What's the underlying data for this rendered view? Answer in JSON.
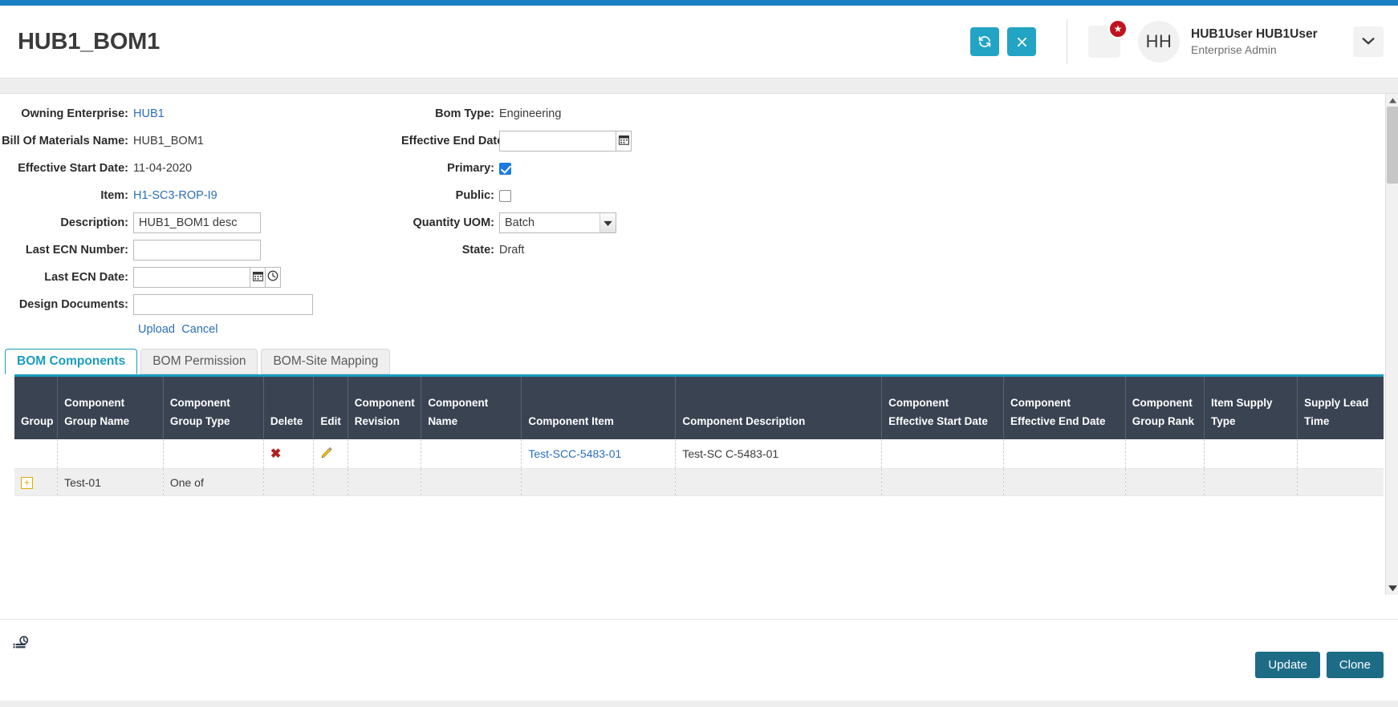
{
  "header": {
    "title": "HUB1_BOM1",
    "refresh_icon": "refresh-icon",
    "close_icon": "close-icon",
    "menu_icon": "hamburger-menu-icon",
    "notification_badge": "★",
    "avatar_initials": "HH",
    "user_name": "HUB1User HUB1User",
    "user_role": "Enterprise Admin",
    "caret_icon": "chevron-down-icon"
  },
  "form": {
    "left": {
      "owning_enterprise_label": "Owning Enterprise:",
      "owning_enterprise_value": "HUB1",
      "bom_name_label": "Bill Of Materials Name:",
      "bom_name_value": "HUB1_BOM1",
      "eff_start_label": "Effective Start Date:",
      "eff_start_value": "11-04-2020",
      "item_label": "Item:",
      "item_value": "H1-SC3-ROP-I9",
      "description_label": "Description:",
      "description_value": "HUB1_BOM1 desc",
      "last_ecn_number_label": "Last ECN Number:",
      "last_ecn_number_value": "",
      "last_ecn_date_label": "Last ECN Date:",
      "last_ecn_date_value": "",
      "design_documents_label": "Design Documents:",
      "design_documents_value": "",
      "upload_link": "Upload",
      "cancel_link": "Cancel"
    },
    "right": {
      "bom_type_label": "Bom Type:",
      "bom_type_value": "Engineering",
      "eff_end_label": "Effective End Date:",
      "eff_end_value": "",
      "primary_label": "Primary:",
      "primary_checked": true,
      "public_label": "Public:",
      "public_checked": false,
      "quantity_uom_label": "Quantity UOM:",
      "quantity_uom_value": "Batch",
      "quantity_uom_options": [
        "Batch"
      ],
      "state_label": "State:",
      "state_value": "Draft"
    }
  },
  "tabs": [
    {
      "label": "BOM Components",
      "active": true
    },
    {
      "label": "BOM Permission",
      "active": false
    },
    {
      "label": "BOM-Site Mapping",
      "active": false
    }
  ],
  "grid": {
    "columns": [
      "Group",
      "Component Group Name",
      "Component Group Type",
      "Delete",
      "Edit",
      "Component Revision",
      "Component Name",
      "Component Item",
      "Component Description",
      "Component Effective Start Date",
      "Component Effective End Date",
      "Component Group Rank",
      "Item Supply Type",
      "Supply Lead Time"
    ],
    "rows": [
      {
        "group": "",
        "component_group_name": "",
        "component_group_type": "",
        "delete": "✖",
        "edit": "✎",
        "component_revision": "",
        "component_name": "",
        "component_item": "Test-SCC-5483-01",
        "component_description": "Test-SC C-5483-01",
        "component_effective_start_date": "",
        "component_effective_end_date": "",
        "component_group_rank": "",
        "item_supply_type": "",
        "supply_lead_time": ""
      },
      {
        "group": "+",
        "component_group_name": "Test-01",
        "component_group_type": "One of",
        "delete": "",
        "edit": "",
        "component_revision": "",
        "component_name": "",
        "component_item": "",
        "component_description": "",
        "component_effective_start_date": "",
        "component_effective_end_date": "",
        "component_group_rank": "",
        "item_supply_type": "",
        "supply_lead_time": ""
      }
    ]
  },
  "footer": {
    "history_icon": "history-clock-icon",
    "update_label": "Update",
    "clone_label": "Clone"
  },
  "colors": {
    "top_strip": "#1b7fc4",
    "accent_teal": "#23a4c4",
    "tab_active": "#1a9cbf",
    "grid_header": "#3a4352",
    "link": "#2a6ebb",
    "button": "#1d6c86",
    "badge_red": "#c1121f"
  }
}
